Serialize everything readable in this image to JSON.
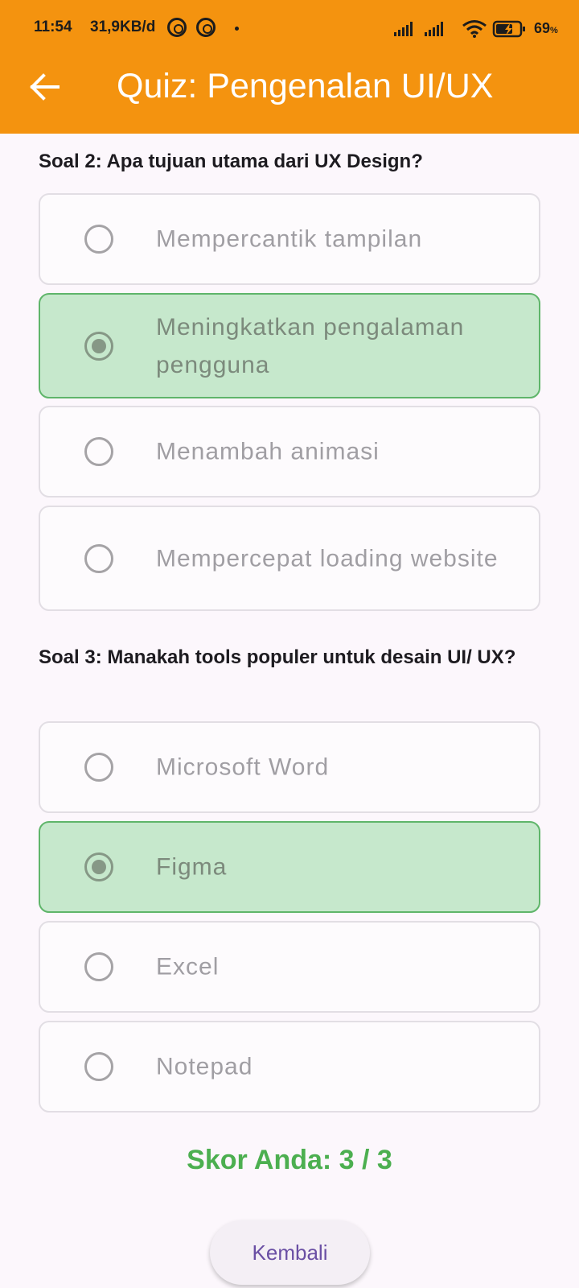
{
  "status_bar": {
    "time": "11:54",
    "speed": "31,9KB/d",
    "battery": "69",
    "battery_unit": "%"
  },
  "app_bar": {
    "title": "Quiz: Pengenalan UI/UX"
  },
  "questions": [
    {
      "text": "Soal 2: Apa tujuan utama dari UX Design?",
      "options": [
        {
          "label": "Mempercantik tampilan",
          "selected": false
        },
        {
          "label": "Meningkatkan pengalaman pengguna",
          "selected": true
        },
        {
          "label": "Menambah animasi",
          "selected": false
        },
        {
          "label": "Mempercepat loading website",
          "selected": false
        }
      ]
    },
    {
      "text": "Soal 3: Manakah tools populer untuk desain UI/ UX?",
      "options": [
        {
          "label": "Microsoft Word",
          "selected": false
        },
        {
          "label": "Figma",
          "selected": true
        },
        {
          "label": "Excel",
          "selected": false
        },
        {
          "label": "Notepad",
          "selected": false
        }
      ]
    }
  ],
  "score_text": "Skor Anda: 3 / 3",
  "back_button_label": "Kembali",
  "colors": {
    "app_bar": "#f4930f",
    "selected_option_bg": "#c6e8cc",
    "score": "#4caf50",
    "button_text": "#6a4fa4"
  }
}
